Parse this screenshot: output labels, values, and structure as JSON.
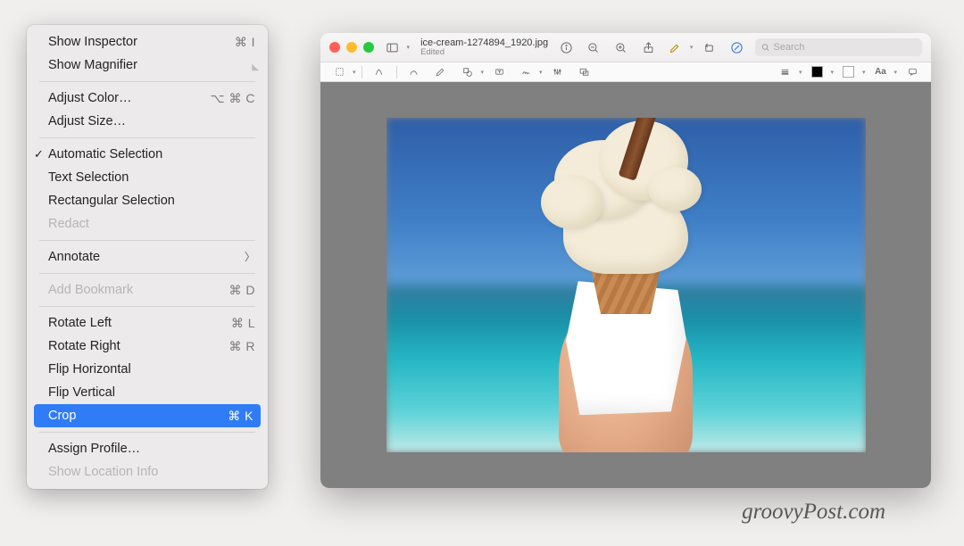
{
  "menu": {
    "showInspector": {
      "label": "Show Inspector",
      "shortcut": "⌘ I"
    },
    "showMagnifier": {
      "label": "Show Magnifier"
    },
    "adjustColor": {
      "label": "Adjust Color…",
      "shortcut": "⌥ ⌘ C"
    },
    "adjustSize": {
      "label": "Adjust Size…"
    },
    "autoSelection": {
      "label": "Automatic Selection"
    },
    "textSelection": {
      "label": "Text Selection"
    },
    "rectSelection": {
      "label": "Rectangular Selection"
    },
    "redact": {
      "label": "Redact"
    },
    "annotate": {
      "label": "Annotate"
    },
    "addBookmark": {
      "label": "Add Bookmark",
      "shortcut": "⌘ D"
    },
    "rotateLeft": {
      "label": "Rotate Left",
      "shortcut": "⌘ L"
    },
    "rotateRight": {
      "label": "Rotate Right",
      "shortcut": "⌘ R"
    },
    "flipH": {
      "label": "Flip Horizontal"
    },
    "flipV": {
      "label": "Flip Vertical"
    },
    "crop": {
      "label": "Crop",
      "shortcut": "⌘ K"
    },
    "assignProfile": {
      "label": "Assign Profile…"
    },
    "locationInfo": {
      "label": "Show Location Info"
    }
  },
  "window": {
    "filename": "ice-cream-1274894_1920.jpg",
    "status": "Edited",
    "searchPlaceholder": "Search"
  },
  "colors": {
    "highlight": "#2f7cf6"
  },
  "watermark": "groovyPost.com"
}
